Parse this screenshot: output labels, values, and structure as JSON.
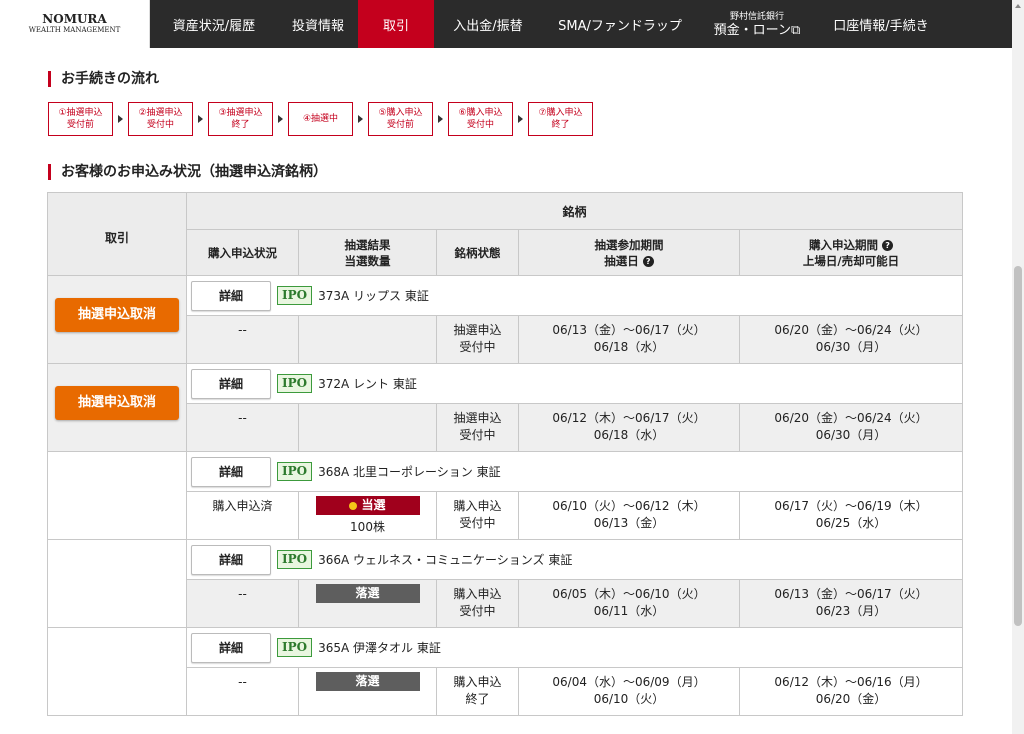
{
  "nav": {
    "logo_line1": "NOMURA",
    "logo_line2": "WEALTH MANAGEMENT",
    "items": [
      {
        "label": "資産状況/履歴"
      },
      {
        "label": "投資情報"
      },
      {
        "label": "取引"
      },
      {
        "label": "入出金/振替"
      },
      {
        "label": "SMA/ファンドラップ"
      }
    ],
    "bank_sub": "野村信託銀行",
    "bank_main": "預金・ローン⧉",
    "account": "口座情報/手続き"
  },
  "flow": {
    "title": "お手続きの流れ",
    "steps": [
      {
        "l1": "①抽選申込",
        "l2": "受付前"
      },
      {
        "l1": "②抽選申込",
        "l2": "受付中"
      },
      {
        "l1": "③抽選申込",
        "l2": "終了"
      },
      {
        "l1": "④抽選中",
        "l2": ""
      },
      {
        "l1": "⑤購入申込",
        "l2": "受付前"
      },
      {
        "l1": "⑥購入申込",
        "l2": "受付中"
      },
      {
        "l1": "⑦購入申込",
        "l2": "終了"
      }
    ]
  },
  "status": {
    "title": "お客様のお申込み状況（抽選申込済銘柄）",
    "headers": {
      "trade": "取引",
      "issue": "銘柄",
      "purchase_status": "購入申込状況",
      "result_l1": "抽選結果",
      "result_l2": "当選数量",
      "issue_state": "銘柄状態",
      "lottery_l1": "抽選参加期間",
      "lottery_l2": "抽選日",
      "purchase_l1": "購入申込期間",
      "purchase_l2": "上場日/売却可能日",
      "help": "?"
    },
    "detail_label": "詳細",
    "ipo_label": "IPO",
    "cancel_label": "抽選申込取消",
    "rows": [
      {
        "name": "373A リップス 東証",
        "purchase_status": "--",
        "result": "",
        "quantity": "",
        "state_l1": "抽選申込",
        "state_l2": "受付中",
        "lottery_period": "06/13（金）～06/17（火）",
        "lottery_date": "06/18（水）",
        "purchase_period": "06/20（金）～06/24（火）",
        "listing_date": "06/30（月）"
      },
      {
        "name": "372A レント 東証",
        "purchase_status": "--",
        "result": "",
        "quantity": "",
        "state_l1": "抽選申込",
        "state_l2": "受付中",
        "lottery_period": "06/12（木）～06/17（火）",
        "lottery_date": "06/18（水）",
        "purchase_period": "06/20（金）～06/24（火）",
        "listing_date": "06/30（月）"
      },
      {
        "name": "368A 北里コーポレーション 東証",
        "purchase_status": "購入申込済",
        "result": "当選",
        "quantity": "100株",
        "state_l1": "購入申込",
        "state_l2": "受付中",
        "lottery_period": "06/10（火）～06/12（木）",
        "lottery_date": "06/13（金）",
        "purchase_period": "06/17（火）～06/19（木）",
        "listing_date": "06/25（水）"
      },
      {
        "name": "366A ウェルネス・コミュニケーションズ 東証",
        "purchase_status": "--",
        "result": "落選",
        "quantity": "",
        "state_l1": "購入申込",
        "state_l2": "受付中",
        "lottery_period": "06/05（木）～06/10（火）",
        "lottery_date": "06/11（水）",
        "purchase_period": "06/13（金）～06/17（火）",
        "listing_date": "06/23（月）"
      },
      {
        "name": "365A 伊澤タオル 東証",
        "purchase_status": "--",
        "result": "落選",
        "quantity": "",
        "state_l1": "購入申込",
        "state_l2": "終了",
        "lottery_period": "06/04（水）～06/09（月）",
        "lottery_date": "06/10（火）",
        "purchase_period": "06/12（木）～06/16（月）",
        "listing_date": "06/20（金）"
      }
    ]
  },
  "colors": {
    "nav_bg": "#2b2b2b",
    "nav_active": "#c4001d",
    "cancel_btn": "#e86a00",
    "win_badge": "#a0001c",
    "lose_badge": "#5e5e5e",
    "ipo_green": "#3c9a3c"
  }
}
